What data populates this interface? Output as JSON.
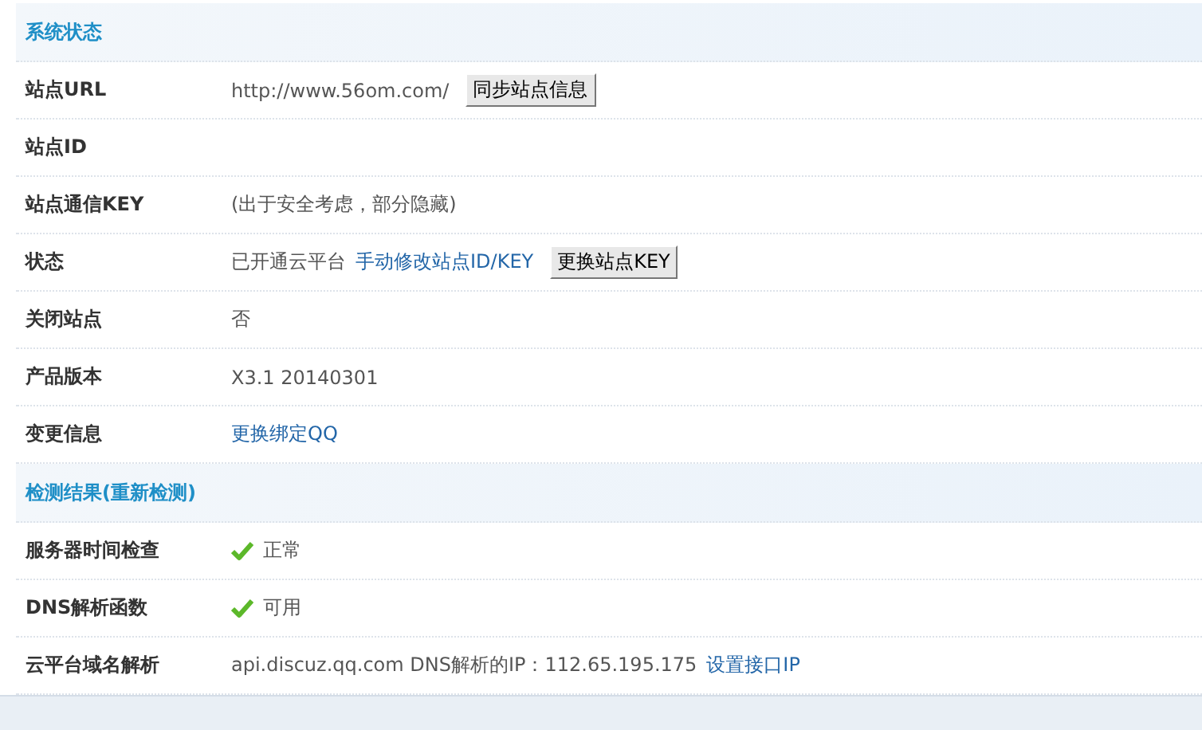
{
  "sections": [
    {
      "title": "系统状态",
      "rows": [
        {
          "label": "站点URL",
          "value": [
            {
              "kind": "text",
              "text": "http://www.56om.com/"
            },
            {
              "kind": "button",
              "text": "同步站点信息"
            }
          ]
        },
        {
          "label": "站点ID",
          "value": []
        },
        {
          "label": "站点通信KEY",
          "value": [
            {
              "kind": "text",
              "text": "(出于安全考虑，部分隐藏)"
            }
          ]
        },
        {
          "label": "状态",
          "value": [
            {
              "kind": "text",
              "text": "已开通云平台"
            },
            {
              "kind": "link",
              "text": "手动修改站点ID/KEY"
            },
            {
              "kind": "button",
              "text": "更换站点KEY"
            }
          ]
        },
        {
          "label": "关闭站点",
          "value": [
            {
              "kind": "text",
              "text": "否"
            }
          ]
        },
        {
          "label": "产品版本",
          "value": [
            {
              "kind": "text",
              "text": "X3.1 20140301"
            }
          ]
        },
        {
          "label": "变更信息",
          "value": [
            {
              "kind": "link",
              "text": "更换绑定QQ"
            }
          ]
        }
      ]
    },
    {
      "title": "检测结果(重新检测)",
      "rows": [
        {
          "label": "服务器时间检查",
          "value": [
            {
              "kind": "check",
              "text": "正常"
            }
          ]
        },
        {
          "label": "DNS解析函数",
          "value": [
            {
              "kind": "check",
              "text": "可用"
            }
          ]
        },
        {
          "label": "云平台域名解析",
          "value": [
            {
              "kind": "text",
              "text": "api.discuz.qq.com DNS解析的IP：112.65.195.175"
            },
            {
              "kind": "link",
              "text": "设置接口IP"
            }
          ]
        }
      ]
    }
  ]
}
